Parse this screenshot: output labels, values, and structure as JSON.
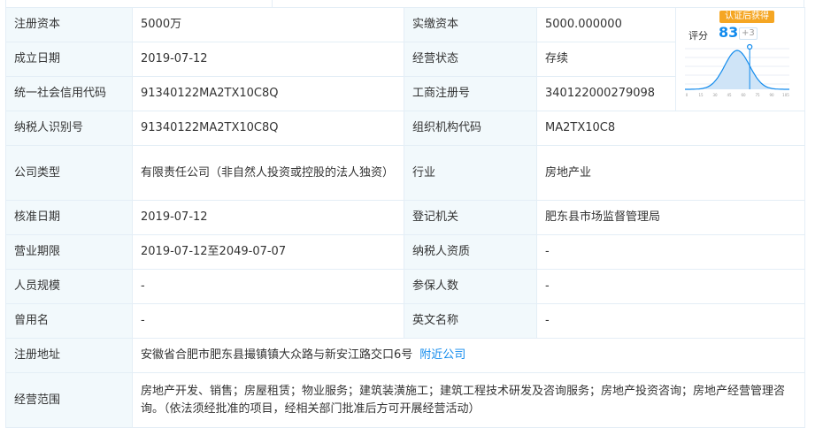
{
  "rows": {
    "reg_capital": {
      "label": "注册资本",
      "value": "5000万"
    },
    "paid_capital": {
      "label": "实缴资本",
      "value": "5000.000000"
    },
    "founded": {
      "label": "成立日期",
      "value": "2019-07-12"
    },
    "status": {
      "label": "经营状态",
      "value": "存续"
    },
    "credit_code": {
      "label": "统一社会信用代码",
      "value": "91340122MA2TX10C8Q"
    },
    "biz_reg_no": {
      "label": "工商注册号",
      "value": "340122000279098"
    },
    "tax_id": {
      "label": "纳税人识别号",
      "value": "91340122MA2TX10C8Q"
    },
    "org_code": {
      "label": "组织机构代码",
      "value": "MA2TX10C8"
    },
    "company_type": {
      "label": "公司类型",
      "value": "有限责任公司（非自然人投资或控股的法人独资）"
    },
    "industry": {
      "label": "行业",
      "value": "房地产业"
    },
    "approval_date": {
      "label": "核准日期",
      "value": "2019-07-12"
    },
    "authority": {
      "label": "登记机关",
      "value": "肥东县市场监督管理局"
    },
    "term": {
      "label": "营业期限",
      "value": "2019-07-12至2049-07-07"
    },
    "taxpayer_qual": {
      "label": "纳税人资质",
      "value": "-"
    },
    "staff_size": {
      "label": "人员规模",
      "value": "-"
    },
    "insured": {
      "label": "参保人数",
      "value": "-"
    },
    "former_name": {
      "label": "曾用名",
      "value": "-"
    },
    "english_name": {
      "label": "英文名称",
      "value": "-"
    },
    "address": {
      "label": "注册地址",
      "value": "安徽省合肥市肥东县撮镇镇大众路与新安江路交口6号",
      "link": "附近公司"
    },
    "scope": {
      "label": "经营范围",
      "value": "房地产开发、销售；房屋租赁；物业服务；建筑装潢施工；建筑工程技术研发及咨询服务；房地产投资咨询；房地产经营管理咨询。（依法须经批准的项目，经相关部门批准后方可开展经营活动）"
    }
  },
  "score": {
    "tag": "认证后获得",
    "label": "评分",
    "value": "83",
    "delta": "+3",
    "marker_fraction": 0.62,
    "axis_ticks": [
      "0",
      "15",
      "30",
      "45",
      "60",
      "75",
      "90",
      "105"
    ]
  },
  "colors": {
    "label_bg": "#f2f9fc",
    "border": "#e4eef6",
    "link": "#128bed",
    "tag_bg": "#f5a623"
  }
}
